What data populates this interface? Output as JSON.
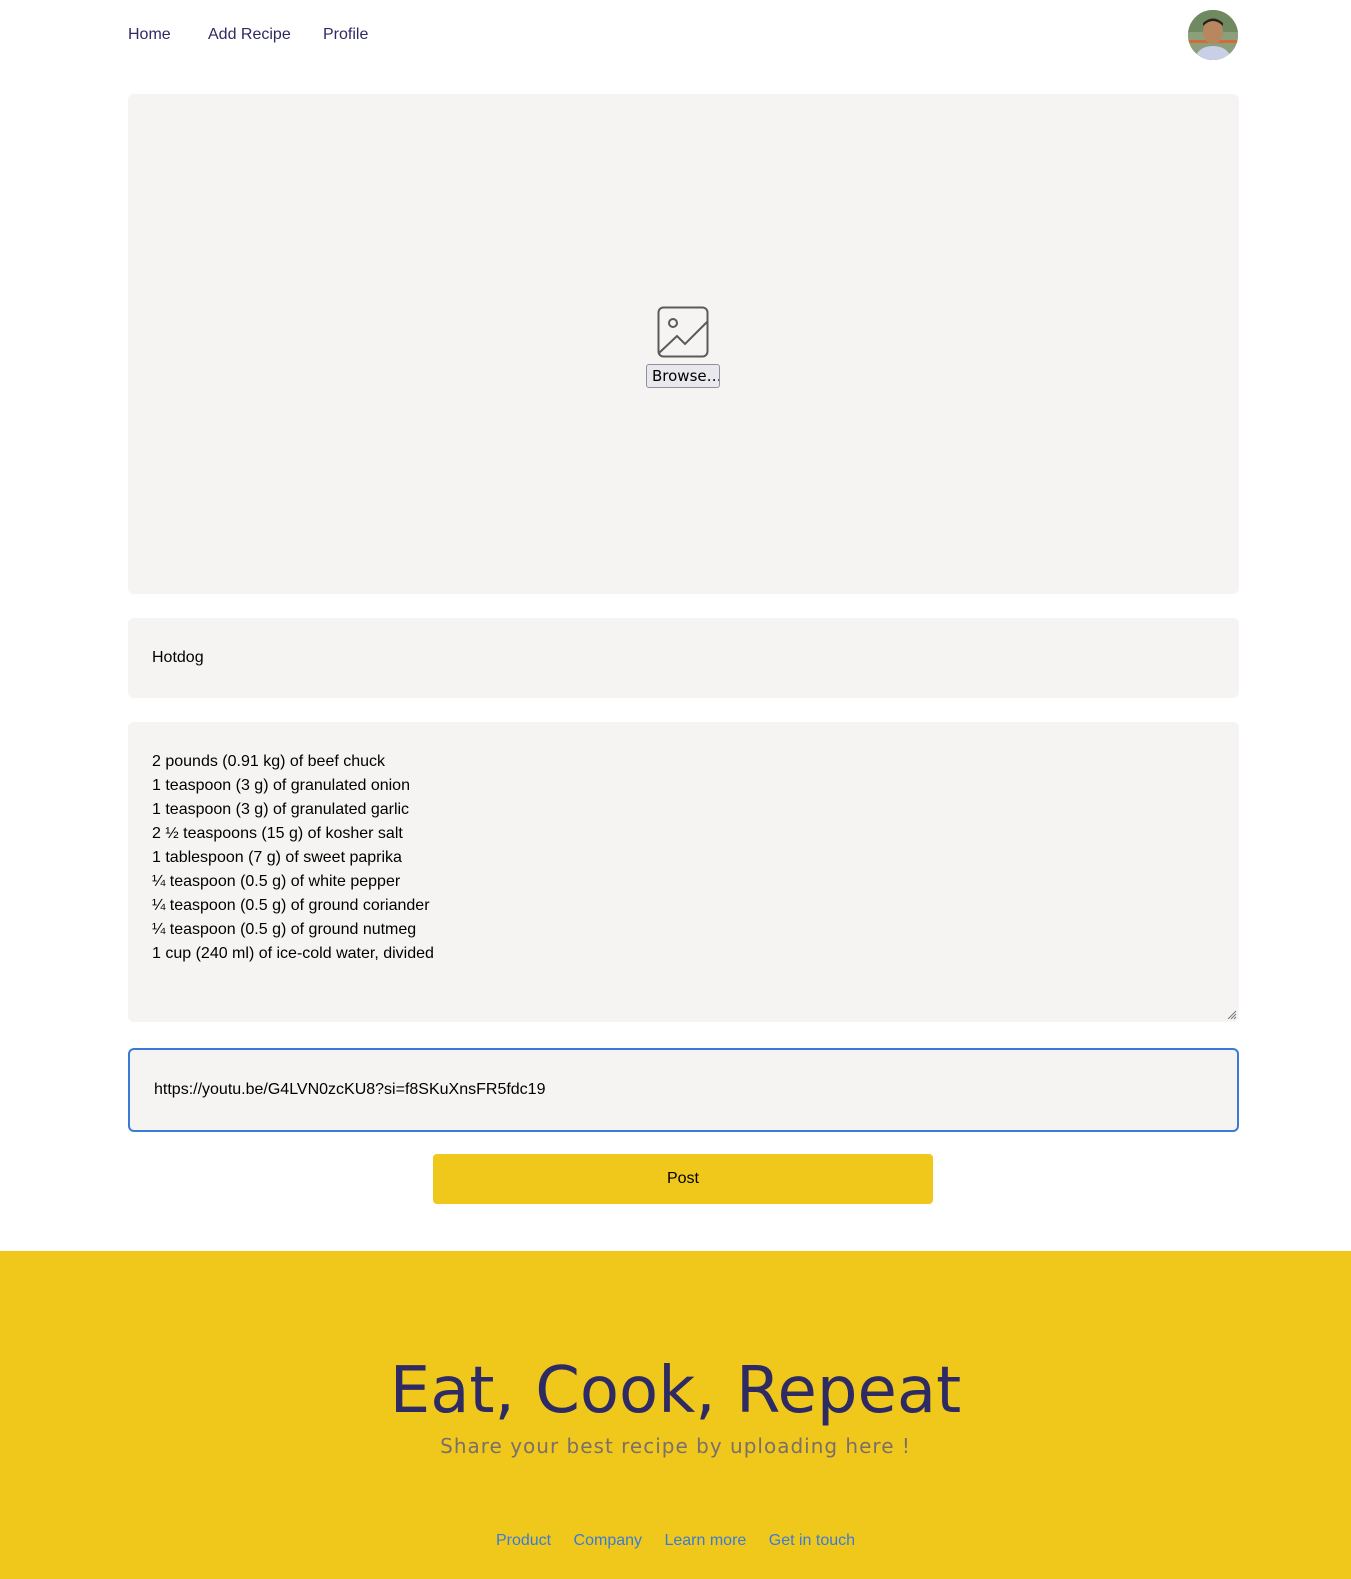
{
  "nav": {
    "links": [
      "Home",
      "Add Recipe",
      "Profile"
    ],
    "avatar_alt": "user avatar"
  },
  "upload": {
    "icon": "image-placeholder-icon",
    "browse_label": "Browse…"
  },
  "form": {
    "title_value": "Hotdog",
    "ingredients": [
      "2 pounds (0.91 kg) of beef chuck",
      "1 teaspoon (3 g) of granulated onion",
      "1 teaspoon (3 g) of granulated garlic",
      "2 ½ teaspoons (15 g) of kosher salt",
      "1 tablespoon (7 g) of sweet paprika",
      "¼ teaspoon (0.5 g) of white pepper",
      "¼ teaspoon (0.5 g) of ground coriander",
      "¼ teaspoon (0.5 g) of ground nutmeg",
      "1 cup (240 ml) of ice-cold water, divided"
    ],
    "video_link_value": "https://youtu.be/G4LVN0zcKU8?si=f8SKuXnsFR5fdc19",
    "post_label": "Post"
  },
  "footer": {
    "headline": "Eat, Cook, Repeat",
    "subtitle": "Share your best recipe by uploading here !",
    "links": [
      "Product",
      "Company",
      "Learn more",
      "Get in touch"
    ]
  },
  "colors": {
    "accent_yellow": "#f0c81c",
    "nav_text": "#2e2a63",
    "field_bg": "#f5f4f2",
    "focus_border": "#3b7bd6",
    "footer_link": "#3b7bd6"
  }
}
